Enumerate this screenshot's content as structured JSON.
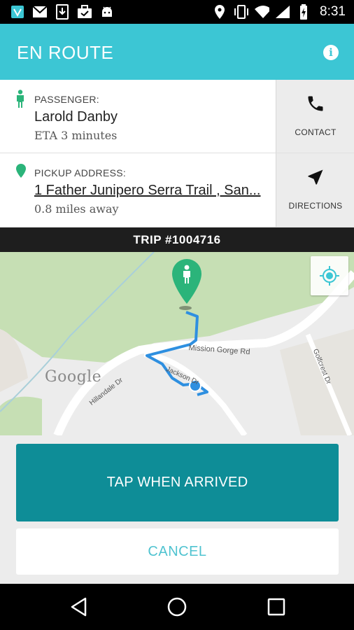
{
  "status_bar": {
    "time": "8:31",
    "left_icons": [
      "app-icon",
      "gmail-icon",
      "download-icon",
      "briefcase-icon",
      "android-icon"
    ],
    "right_icons": [
      "location-icon",
      "vibrate-icon",
      "wifi-icon",
      "signal-icon",
      "battery-charging-icon"
    ]
  },
  "app_bar": {
    "title": "EN ROUTE",
    "info_icon": "i"
  },
  "passenger": {
    "label": "PASSENGER:",
    "name": "Larold Danby",
    "eta": "ETA 3 minutes",
    "contact_label": "CONTACT"
  },
  "pickup": {
    "label": "PICKUP ADDRESS:",
    "address": "1 Father Junipero Serra Trail , San...",
    "distance": "0.8 miles away",
    "directions_label": "DIRECTIONS"
  },
  "trip": {
    "label": "TRIP #1004716"
  },
  "map": {
    "roads": {
      "mission_gorge": "Mission Gorge Rd",
      "hillandale": "Hillandale Dr",
      "jackson": "Jackson Dr",
      "golfcrest": "Golfcrest Dr"
    },
    "attribution": "Google"
  },
  "actions": {
    "arrived_label": "TAP WHEN ARRIVED",
    "cancel_label": "CANCEL"
  },
  "colors": {
    "accent": "#3cc6d4",
    "primary_button": "#0e8d97",
    "marker": "#2bb47a",
    "route": "#2e8fe0"
  }
}
